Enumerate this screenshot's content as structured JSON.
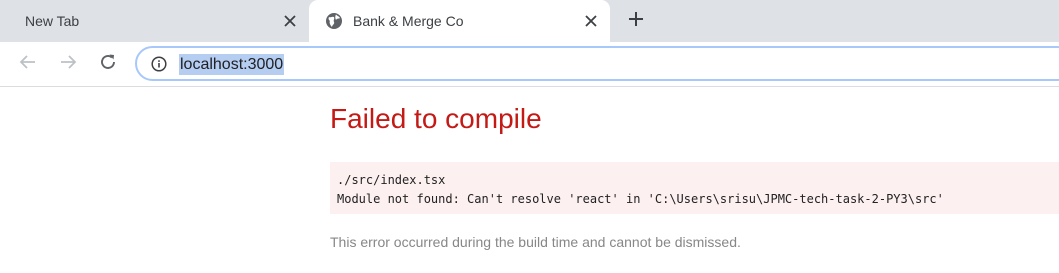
{
  "browser": {
    "tabs": [
      {
        "title": "New Tab",
        "active": false
      },
      {
        "title": "Bank & Merge Co",
        "active": true,
        "favicon": "globe-icon"
      }
    ],
    "new_tab_icon": "plus-icon",
    "close_icon": "close-icon",
    "nav": {
      "back_icon": "arrow-left-icon",
      "forward_icon": "arrow-right-icon",
      "reload_icon": "reload-icon"
    },
    "omnibox": {
      "info_icon": "info-icon",
      "url": "localhost:3000",
      "url_selected": true
    },
    "colors": {
      "tabstrip_bg": "#dee1e6",
      "selection_bg": "#b4cdf1",
      "omnibox_border": "#a8c7fa"
    }
  },
  "page": {
    "error_title": "Failed to compile",
    "error_file": "./src/index.tsx",
    "error_message": "Module not found: Can't resolve 'react' in 'C:\\Users\\srisu\\JPMC-tech-task-2-PY3\\src'",
    "footer_note": "This error occurred during the build time and cannot be dismissed.",
    "colors": {
      "title": "#c41a16",
      "code_bg": "#fcf0f1",
      "footer_text": "#878787"
    }
  }
}
